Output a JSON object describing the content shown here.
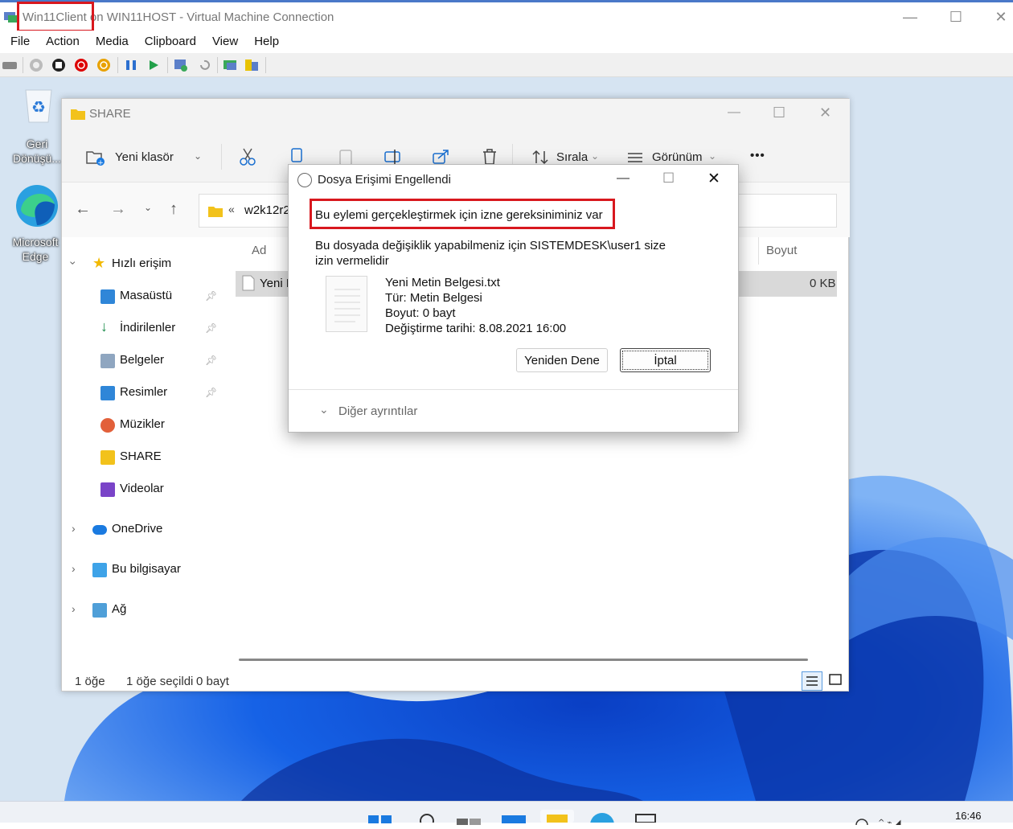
{
  "host": {
    "title": "Win11Client on WIN11HOST - Virtual Machine Connection",
    "menu": [
      "File",
      "Action",
      "Media",
      "Clipboard",
      "View",
      "Help"
    ]
  },
  "desktop": {
    "icons": [
      {
        "label_line1": "Geri",
        "label_line2": "Dönüşü..."
      },
      {
        "label_line1": "Microsoft",
        "label_line2": "Edge"
      }
    ],
    "clock": "16:46"
  },
  "explorer": {
    "title": "SHARE",
    "cmd": {
      "new_folder": "Yeni klasör",
      "sort": "Sırala",
      "view": "Görünüm",
      "more": "•••"
    },
    "address": "w2k12r2",
    "nav": {
      "quick_access": "Hızlı erişim",
      "items": [
        "Masaüstü",
        "İndirilenler",
        "Belgeler",
        "Resimler",
        "Müzikler",
        "SHARE",
        "Videolar"
      ],
      "onedrive": "OneDrive",
      "this_pc": "Bu bilgisayar",
      "network": "Ağ"
    },
    "list": {
      "col_name": "Ad",
      "col_size": "Boyut",
      "row_name": "Yeni N",
      "row_size": "0 KB"
    },
    "status": {
      "count": "1 öğe",
      "selected": "1 öğe seçildi",
      "size": "0 bayt"
    }
  },
  "dialog": {
    "title": "Dosya Erişimi Engellendi",
    "heading": "Bu eylemi gerçekleştirmek için izne gereksiniminiz var",
    "message": "Bu dosyada değişiklik yapabilmeniz için SISTEMDESK\\user1 size izin vermelidir",
    "file_name": "Yeni Metin Belgesi.txt",
    "file_type": "Tür: Metin Belgesi",
    "file_size": "Boyut: 0 bayt",
    "file_modified": "Değiştirme tarihi: 8.08.2021 16:00",
    "retry": "Yeniden Dene",
    "cancel": "İptal",
    "more_details": "Diğer ayrıntılar"
  },
  "colors": {
    "accent": "#d8181e",
    "title_bar_accent": "#4a78c8"
  }
}
